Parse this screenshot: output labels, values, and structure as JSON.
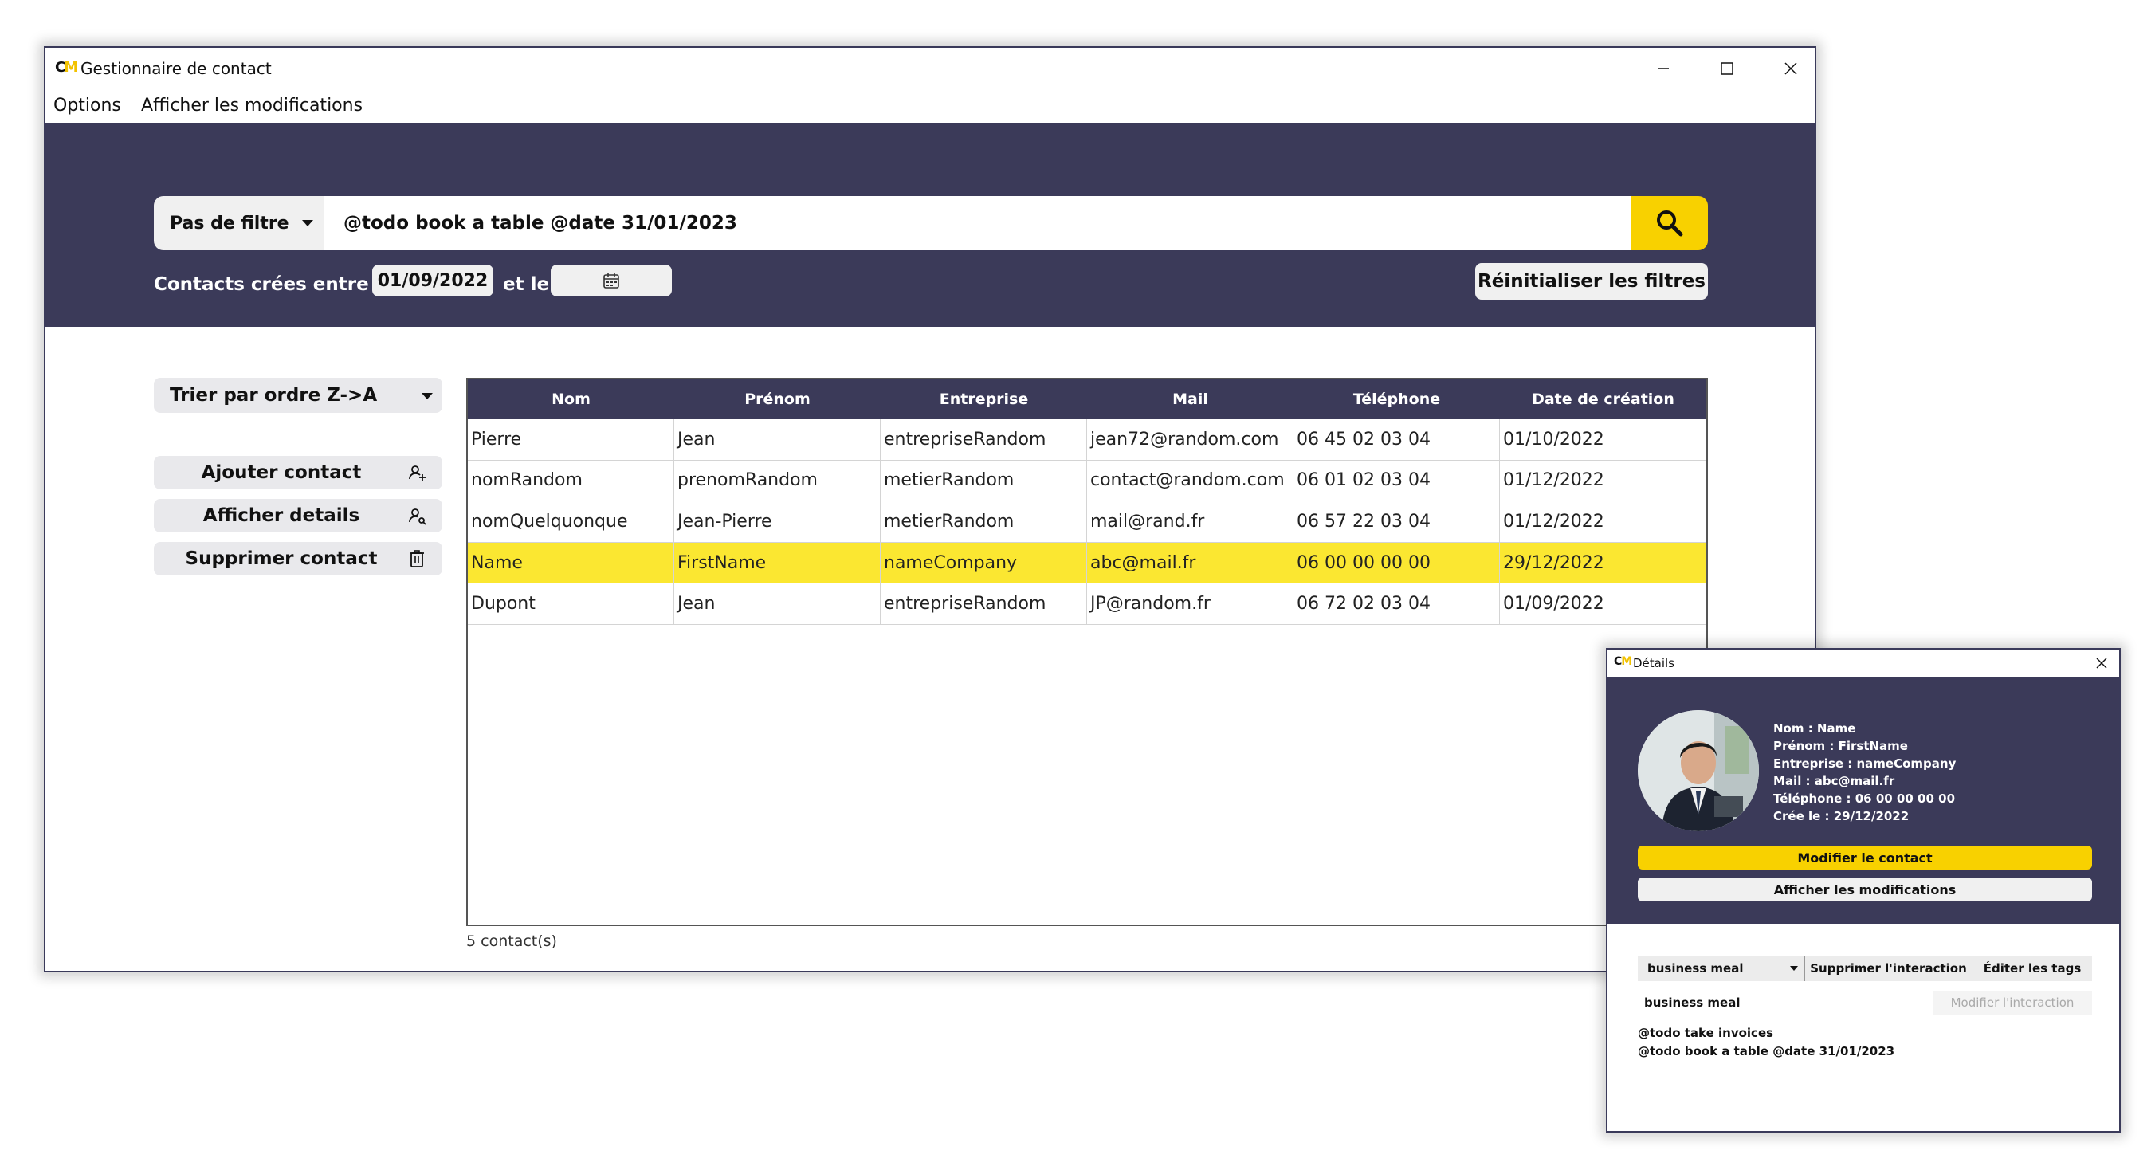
{
  "window": {
    "logo_c": "C",
    "logo_m": "M",
    "title": "Gestionnaire de contact"
  },
  "menu": {
    "options": "Options",
    "show_changes": "Afficher les modifications"
  },
  "filter": {
    "select_value": "Pas de filtre",
    "search_value": "@todo book a table @date 31/01/2023",
    "date_label": "Contacts crées entre le",
    "date_from": "01/09/2022",
    "date_and": "et le",
    "date_to": "",
    "reset_label": "Réinitialiser les filtres"
  },
  "sidebar": {
    "sort_label": "Trier par ordre Z->A",
    "add_label": "Ajouter contact",
    "details_label": "Afficher details",
    "delete_label": "Supprimer contact"
  },
  "table": {
    "headers": [
      "Nom",
      "Prénom",
      "Entreprise",
      "Mail",
      "Téléphone",
      "Date de création"
    ],
    "rows": [
      [
        "Pierre",
        "Jean",
        "entrepriseRandom",
        "jean72@random.com",
        "06 45 02 03 04",
        "01/10/2022"
      ],
      [
        "nomRandom",
        "prenomRandom",
        "metierRandom",
        "contact@random.com",
        "06 01 02 03 04",
        "01/12/2022"
      ],
      [
        "nomQuelquonque",
        "Jean-Pierre",
        "metierRandom",
        "mail@rand.fr",
        "06 57 22 03 04",
        "01/12/2022"
      ],
      [
        "Name",
        "FirstName",
        "nameCompany",
        "abc@mail.fr",
        "06 00 00 00 00",
        "29/12/2022"
      ],
      [
        "Dupont",
        "Jean",
        "entrepriseRandom",
        "JP@random.fr",
        "06 72 02 03 04",
        "01/09/2022"
      ]
    ],
    "selected_row_index": 3,
    "count": "5 contact(s)"
  },
  "colors": {
    "band": "#3b3a59",
    "accent": "#f8d100",
    "selected_row": "#fbe731"
  },
  "details": {
    "title": "Détails",
    "info": [
      "Nom : Name",
      "Prénom : FirstName",
      "Entreprise : nameCompany",
      "Mail : abc@mail.fr",
      "Téléphone : 06 00 00 00 00",
      "Crée le : 29/12/2022"
    ],
    "edit_label": "Modifier le contact",
    "changes_label": "Afficher les modifications",
    "interaction_select": "business meal",
    "delete_interaction": "Supprimer l'interaction",
    "edit_tags": "Éditer les tags",
    "interaction_value": "business meal",
    "modify_interaction": "Modifier l'interaction",
    "notes": [
      "@todo take invoices",
      "@todo book a table @date 31/01/2023"
    ]
  }
}
